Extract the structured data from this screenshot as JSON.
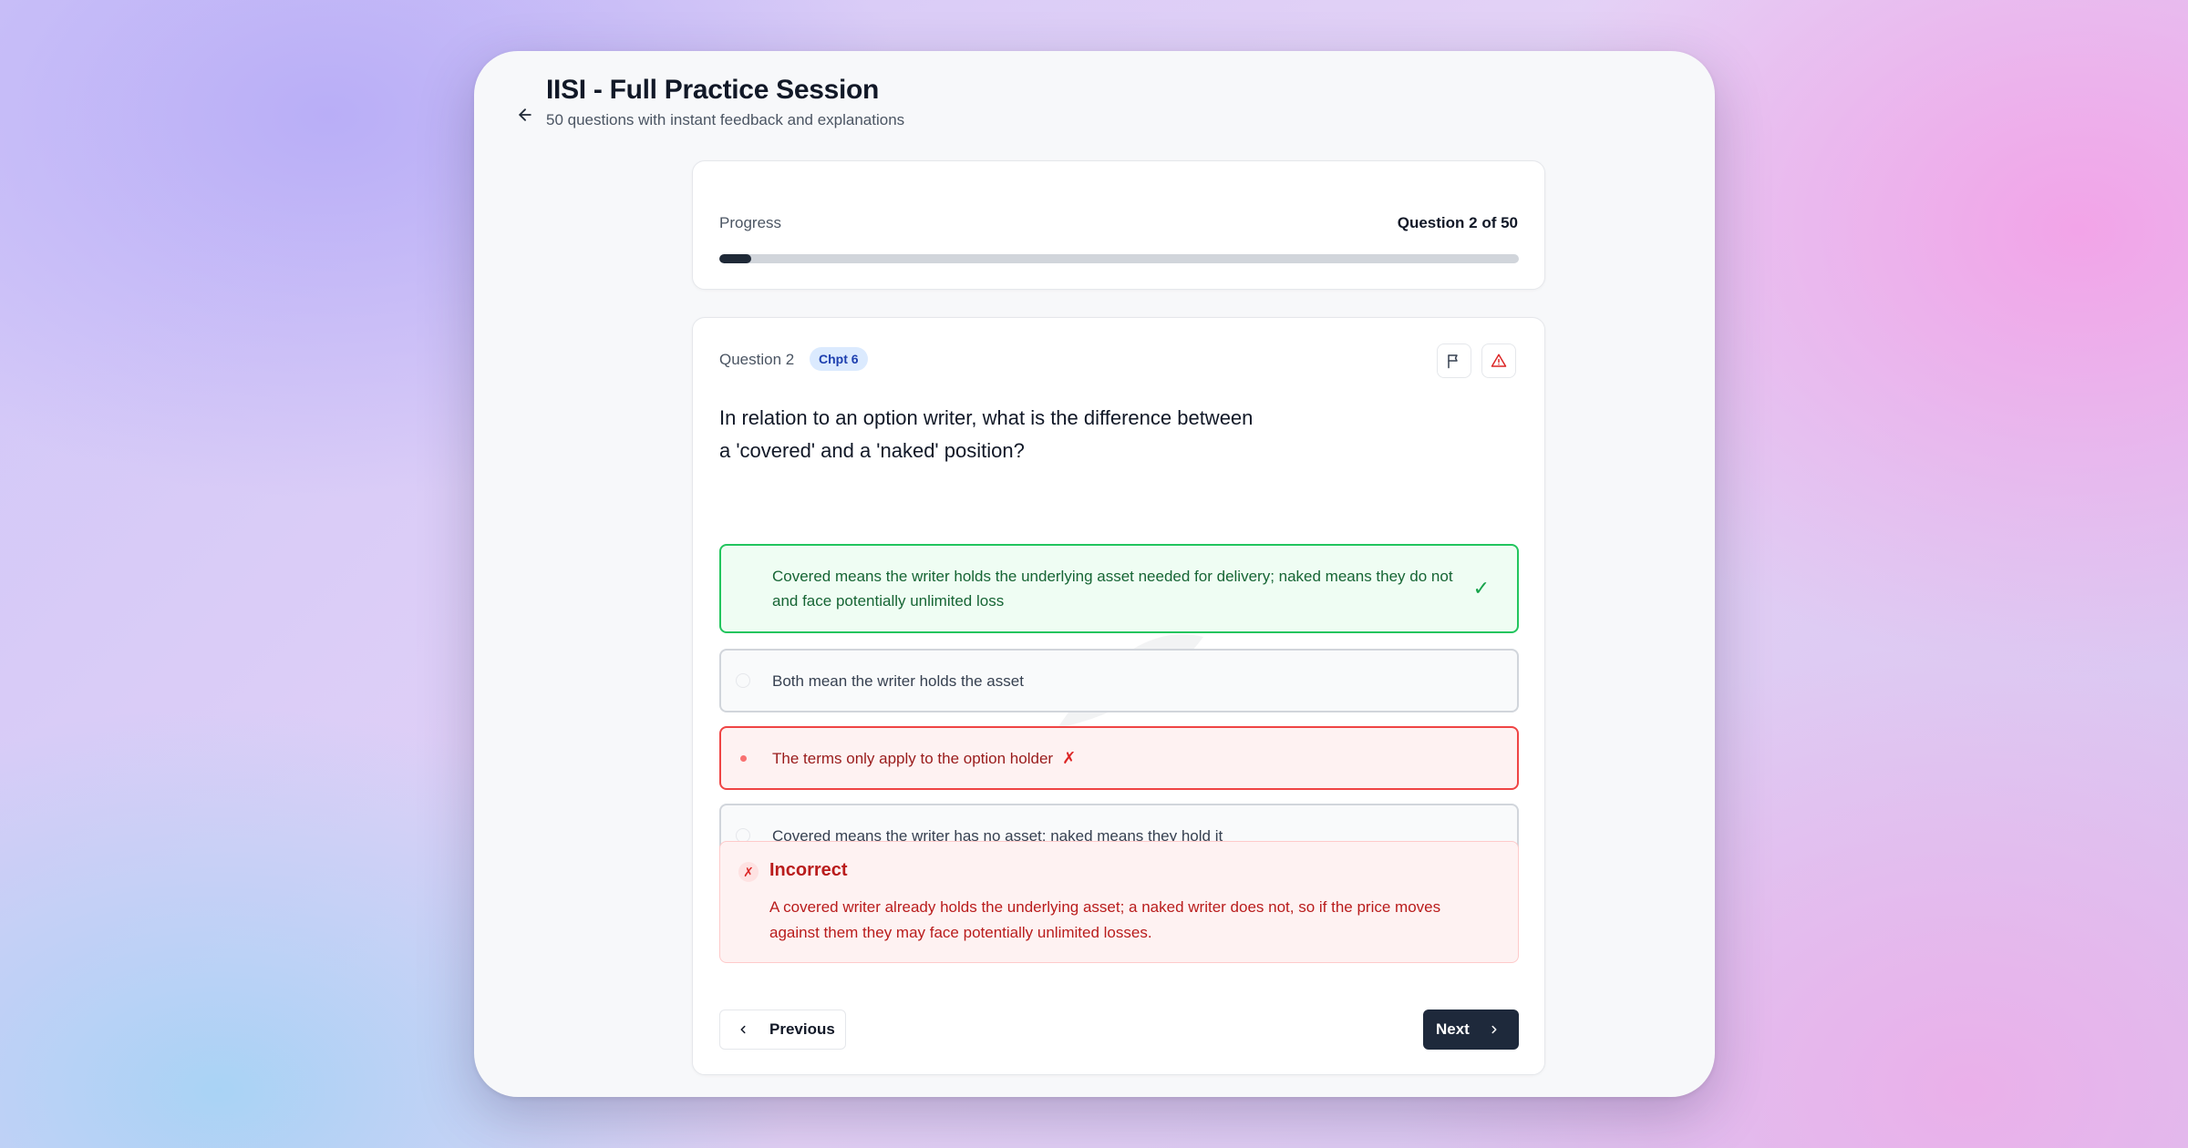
{
  "header": {
    "title": "IISI - Full Practice Session",
    "subtitle": "50 questions with instant feedback and explanations"
  },
  "progress": {
    "label": "Progress",
    "count_text": "Question 2 of 50",
    "fraction": 0.04
  },
  "question": {
    "number_label": "Question 2",
    "chapter_badge": "Chpt 6",
    "text": "In relation to an option writer, what is the difference between a 'covered' and a 'naked' position?",
    "options": [
      {
        "text": "Covered means the writer holds the underlying asset needed for delivery; naked means they do not and face potentially unlimited loss",
        "state": "correct"
      },
      {
        "text": "Both mean the writer holds the asset",
        "state": "neutral"
      },
      {
        "text": "The terms only apply to the option holder",
        "state": "selected-wrong"
      },
      {
        "text": "Covered means the writer has no asset; naked means they hold it",
        "state": "neutral"
      }
    ]
  },
  "feedback": {
    "title": "Incorrect",
    "text": "A covered writer already holds the underlying asset; a naked writer does not, so if the price moves against them they may face potentially unlimited losses."
  },
  "nav": {
    "previous_label": "Previous",
    "next_label": "Next"
  },
  "colors": {
    "correct": "#22c55e",
    "wrong": "#ef4444",
    "primary_dark": "#1e293b",
    "badge_bg": "#dbeafe"
  }
}
